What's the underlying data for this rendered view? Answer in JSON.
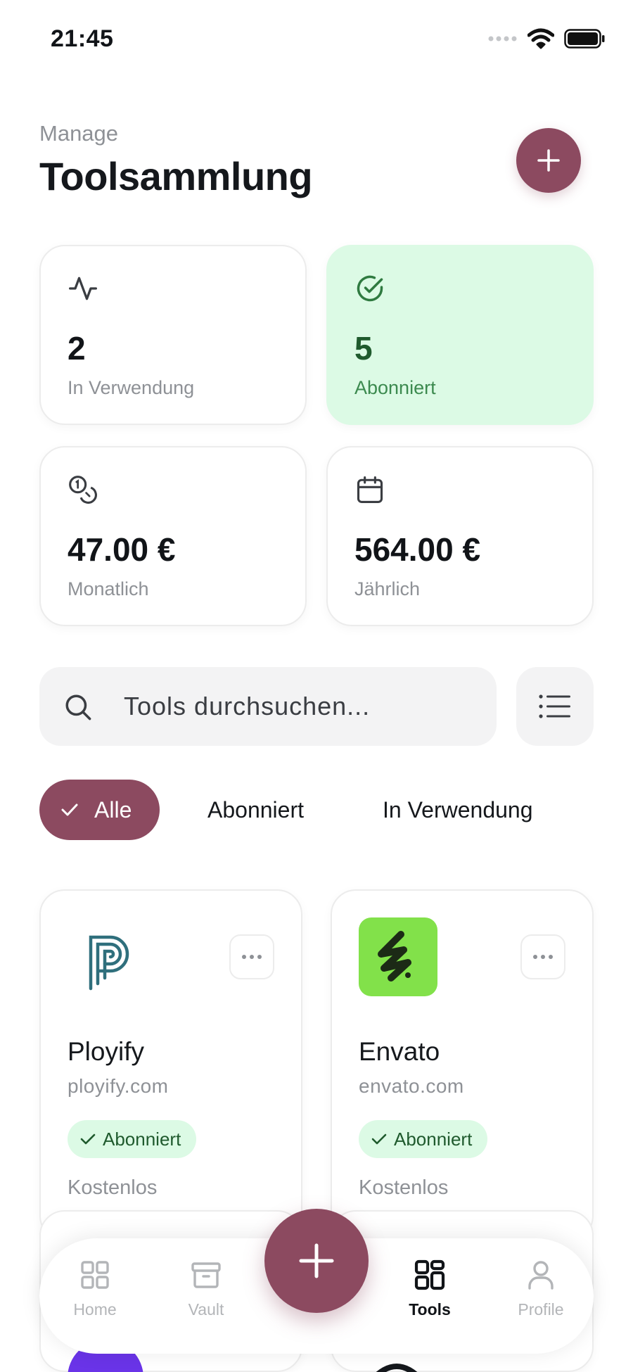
{
  "status_bar": {
    "time": "21:45"
  },
  "header": {
    "subtitle": "Manage",
    "title": "Toolsammlung"
  },
  "stats": [
    {
      "value": "2",
      "label": "In Verwendung",
      "icon": "activity-icon"
    },
    {
      "value": "5",
      "label": "Abonniert",
      "icon": "check-circle-icon"
    },
    {
      "value": "47.00 €",
      "label": "Monatlich",
      "icon": "coins-icon"
    },
    {
      "value": "564.00 €",
      "label": "Jährlich",
      "icon": "calendar-icon"
    }
  ],
  "search": {
    "placeholder": "Tools durchsuchen..."
  },
  "filters": [
    {
      "label": "Alle",
      "active": true
    },
    {
      "label": "Abonniert",
      "active": false
    },
    {
      "label": "In Verwendung",
      "active": false
    }
  ],
  "tools": [
    {
      "name": "Ployify",
      "domain": "ployify.com",
      "status": "Abonniert",
      "price": "Kostenlos"
    },
    {
      "name": "Envato",
      "domain": "envato.com",
      "status": "Abonniert",
      "price": "Kostenlos"
    }
  ],
  "nav": [
    {
      "label": "Home",
      "icon": "grid-icon",
      "active": false
    },
    {
      "label": "Vault",
      "icon": "archive-icon",
      "active": false
    },
    {
      "label": "Tools",
      "icon": "tools-grid-icon",
      "active": true
    },
    {
      "label": "Profile",
      "icon": "user-icon",
      "active": false
    }
  ],
  "colors": {
    "accent": "#8c4a60",
    "success_bg": "#dcfae5",
    "success_text": "#1f5a2d",
    "envato_green": "#82e14a"
  }
}
